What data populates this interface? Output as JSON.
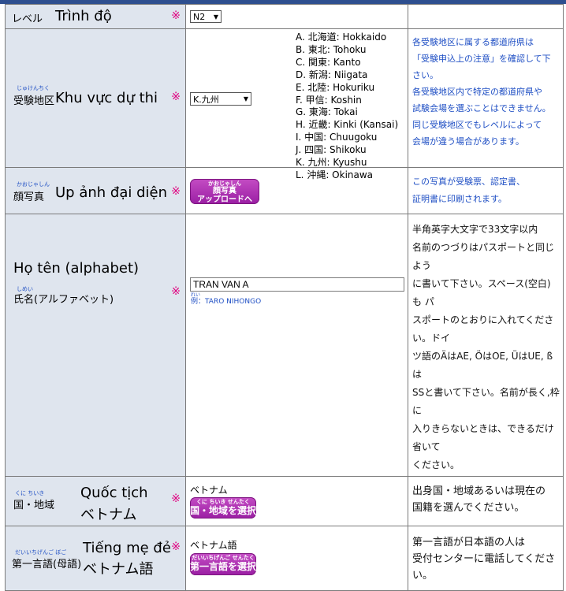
{
  "level": {
    "label_jp": "レベル",
    "label_vn": "Trình độ",
    "value": "N2",
    "required": "※"
  },
  "region": {
    "ruby": "じゅけんちく",
    "label_jp": "受験地区",
    "label_vn": "Khu vực dự thi",
    "selected": "K.九州",
    "required": "※",
    "options": [
      "A. 北海道: Hokkaido",
      "B. 東北: Tohoku",
      "C. 関東: Kanto",
      "D. 新潟: Niigata",
      "E. 北陸: Hokuriku",
      "F.  甲信: Koshin",
      "G. 東海: Tokai",
      "H. 近畿: Kinki (Kansai)",
      "I.  中国: Chuugoku",
      "J. 四国: Shikoku",
      "K. 九州: Kyushu",
      "L. 沖縄: Okinawa"
    ],
    "note_lines": [
      "各受験地区に属する都道府県は",
      "「受験申込上の注意」を確認して下",
      "さい。",
      "各受験地区内で特定の都道府県や",
      "試験会場を選ぶことはできません。",
      "同じ受験地区でもレベルによって",
      "会場が違う場合があります。"
    ]
  },
  "photo": {
    "ruby": "かおじゃしん",
    "label_jp": "顔写真",
    "label_vn": "Up ảnh đại diện",
    "required": "※",
    "button_ruby": "かおじゃしん",
    "button_line1": "顔写真",
    "button_line2": "アップロードへ",
    "note_lines": [
      "この写真が受験票、認定書、",
      "証明書に印刷されます。"
    ]
  },
  "name": {
    "label_vn": "Họ tên (alphabet)",
    "ruby": "しめい",
    "label_jp": "氏名(アルファベット)",
    "required": "※",
    "value": "TRAN VAN A",
    "example_ruby": "れい",
    "example": "例：TARO NIHONGO",
    "note_lines": [
      "半角英字大文字で33文字以内",
      "名前のつづりはパスポートと同じよう",
      "に書いて下さい。スペース(空白)も パ",
      "スポートのとおりに入れてください。ドイ",
      "ツ語のÄはAE, ÖはOE, ÜはUE, ßは",
      "SSと書いて下さい。名前が長く,枠に",
      "入りきらないときは、できるだけ省いて",
      "ください。"
    ]
  },
  "nationality": {
    "ruby": "くに  ちいき",
    "label_jp": "国・地域",
    "label_vn_1": "Quốc tịch",
    "label_vn_2": "ベトナム",
    "required": "※",
    "value": "ベトナム",
    "button_ruby": "くに  ちいき    せんたく",
    "button_label": "国・地域を選択",
    "note_lines": [
      "出身国・地域あるいは現在の",
      "国籍を選んでください。"
    ]
  },
  "language": {
    "ruby": "だいいちげんご  ぼご",
    "label_jp": "第一言語(母語)",
    "label_vn_1": "Tiếng mẹ đẻ",
    "label_vn_2": "ベトナム語",
    "required": "※",
    "value": "ベトナム語",
    "button_ruby": "だいいちげんご   せんたく",
    "button_label": "第一言語を選択",
    "note_lines": [
      "第一言語が日本語の人は",
      "受付センターに電話してくださ",
      "い。"
    ]
  }
}
